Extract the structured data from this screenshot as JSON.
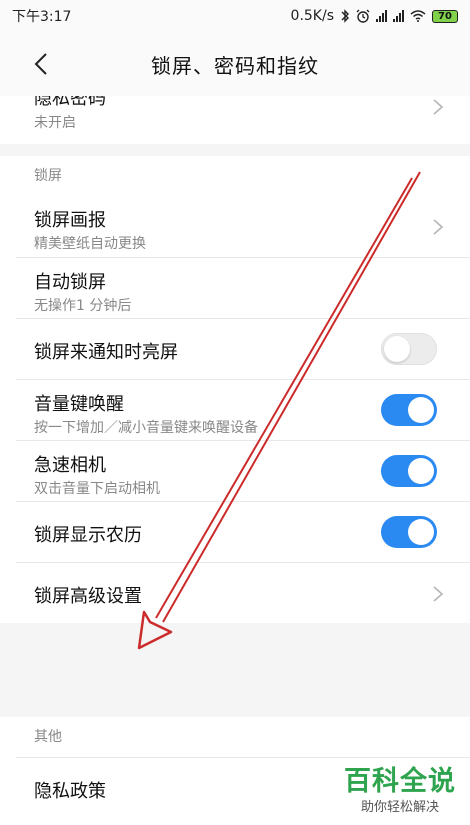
{
  "status_bar": {
    "time": "下午3:17",
    "network_speed": "0.5K/s",
    "battery": "70"
  },
  "header": {
    "title": "锁屏、密码和指纹"
  },
  "top_item": {
    "label": "隐私密码",
    "subtitle": "未开启"
  },
  "lock_section": {
    "title": "锁屏",
    "items": [
      {
        "label": "锁屏画报",
        "subtitle": "精美壁纸自动更换",
        "control": "chevron"
      },
      {
        "label": "自动锁屏",
        "subtitle": "无操作1 分钟后",
        "control": "none"
      },
      {
        "label": "锁屏来通知时亮屏",
        "subtitle": "",
        "control": "toggle",
        "on": false
      },
      {
        "label": "音量键唤醒",
        "subtitle": "按一下增加／减小音量键来唤醒设备",
        "control": "toggle",
        "on": true
      },
      {
        "label": "急速相机",
        "subtitle": "双击音量下启动相机",
        "control": "toggle",
        "on": true
      },
      {
        "label": "锁屏显示农历",
        "subtitle": "",
        "control": "toggle",
        "on": true
      },
      {
        "label": "锁屏高级设置",
        "subtitle": "",
        "control": "chevron"
      }
    ]
  },
  "other_section": {
    "title": "其他",
    "items": [
      {
        "label": "隐私政策"
      }
    ]
  },
  "watermark": {
    "main": "百科全说",
    "sub": "助你轻松解决"
  },
  "colors": {
    "toggle_on": "#2b8af2",
    "annotation_arrow": "#cc2b2b",
    "watermark_green": "#2ea44f"
  }
}
